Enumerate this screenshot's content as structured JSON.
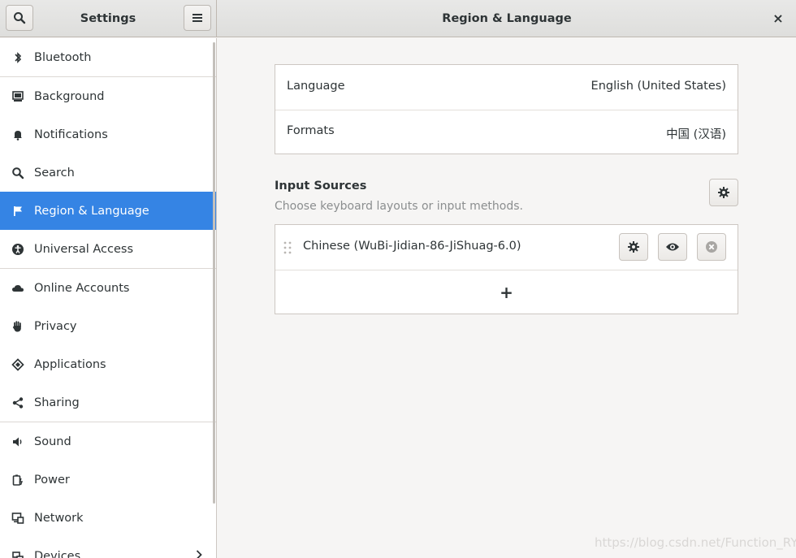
{
  "header": {
    "left_title": "Settings",
    "main_title": "Region & Language",
    "close_glyph": "×"
  },
  "sidebar": {
    "items": [
      {
        "label": "Bluetooth",
        "icon": "bluetooth-icon"
      },
      {
        "label": "Background",
        "icon": "background-icon"
      },
      {
        "label": "Notifications",
        "icon": "bell-icon"
      },
      {
        "label": "Search",
        "icon": "search-icon"
      },
      {
        "label": "Region & Language",
        "icon": "flag-icon",
        "active": true
      },
      {
        "label": "Universal Access",
        "icon": "accessibility-icon"
      },
      {
        "label": "Online Accounts",
        "icon": "cloud-icon"
      },
      {
        "label": "Privacy",
        "icon": "hand-icon"
      },
      {
        "label": "Applications",
        "icon": "applications-icon"
      },
      {
        "label": "Sharing",
        "icon": "share-icon"
      },
      {
        "label": "Sound",
        "icon": "speaker-icon"
      },
      {
        "label": "Power",
        "icon": "power-icon"
      },
      {
        "label": "Network",
        "icon": "network-icon"
      },
      {
        "label": "Devices",
        "icon": "devices-icon"
      }
    ]
  },
  "region": {
    "language_label": "Language",
    "language_value": "English (United States)",
    "formats_label": "Formats",
    "formats_value": "中国 (汉语)"
  },
  "input_sources": {
    "title": "Input Sources",
    "subtitle": "Choose keyboard layouts or input methods.",
    "sources": [
      {
        "name": "Chinese (WuBi-Jidian-86-JiShuag-6.0)"
      }
    ],
    "add_glyph": "+"
  },
  "watermark": "https://blog.csdn.net/Function_RY",
  "colors": {
    "accent": "#3584e4",
    "sidebar_bg": "#ffffff",
    "content_bg": "#f6f5f4"
  }
}
